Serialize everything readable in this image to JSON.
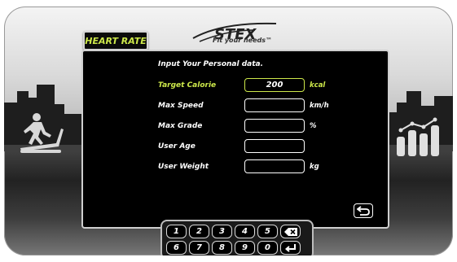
{
  "header": {
    "mode_tab": "HEART RATE",
    "logo_text": "STEX",
    "logo_tagline": "Fit your needs™"
  },
  "panel": {
    "title": "Input Your Personal data.",
    "rows": [
      {
        "label": "Target Calorie",
        "value": "200",
        "unit": "kcal",
        "active": true
      },
      {
        "label": "Max Speed",
        "value": "",
        "unit": "km/h",
        "active": false
      },
      {
        "label": "Max Grade",
        "value": "",
        "unit": "%",
        "active": false
      },
      {
        "label": "User Age",
        "value": "",
        "unit": "",
        "active": false
      },
      {
        "label": "User Weight",
        "value": "",
        "unit": "kg",
        "active": false
      }
    ]
  },
  "keypad": {
    "row1": [
      "1",
      "2",
      "3",
      "4",
      "5"
    ],
    "row2": [
      "6",
      "7",
      "8",
      "9",
      "0"
    ]
  },
  "colors": {
    "accent": "#cde84a",
    "panel_bg": "#000000",
    "text": "#ffffff"
  },
  "icons": {
    "back": "return-arrow-icon",
    "delete": "backspace-icon",
    "enter": "enter-icon",
    "left_art": "treadmill-runner-icon",
    "right_art": "bar-chart-icon"
  }
}
